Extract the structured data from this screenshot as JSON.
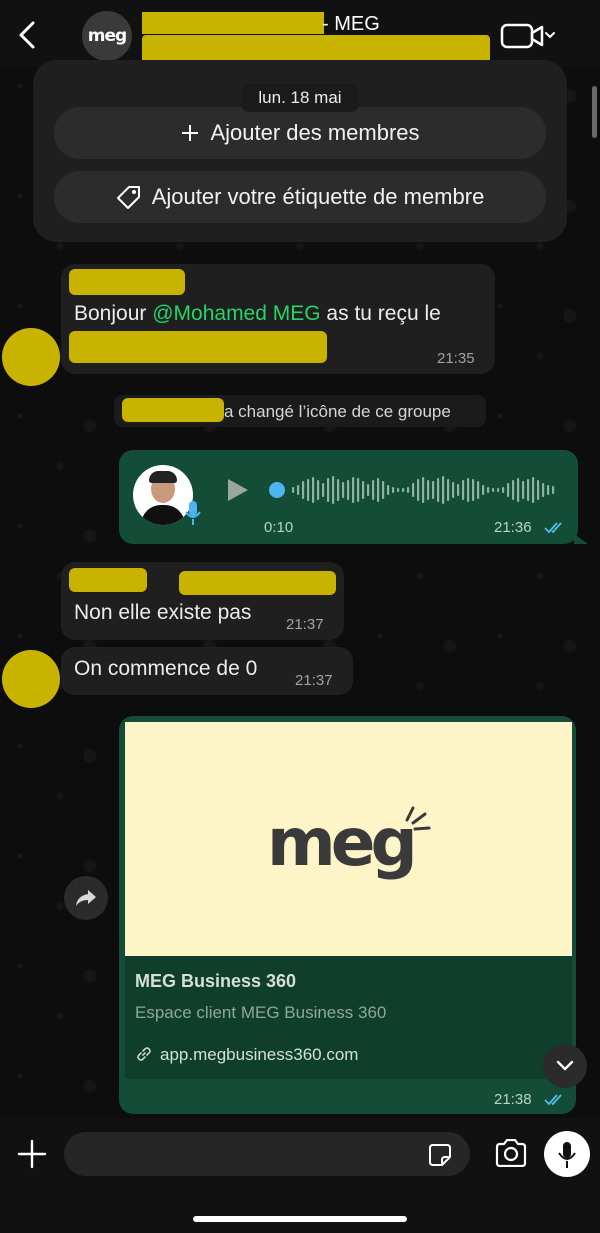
{
  "header": {
    "title_suffix": "- MEG",
    "avatar_text": "meg"
  },
  "date_separator": "lun. 18 mai",
  "top_card": {
    "add_members_label": "Ajouter des membres",
    "add_label_label": "Ajouter votre étiquette de membre"
  },
  "messages": {
    "m1": {
      "text_before": "Bonjour ",
      "mention": "@Mohamed MEG",
      "text_after": " as tu reçu le",
      "time": "21:35"
    },
    "system": {
      "text": "a changé l’icône de ce groupe"
    },
    "voice": {
      "duration": "0:10",
      "time": "21:36"
    },
    "m2": {
      "text": "Non elle existe pas",
      "time": "21:37"
    },
    "m3": {
      "text": "On commence de 0",
      "time": "21:37"
    },
    "link": {
      "logo_text": "meg",
      "title": "MEG Business 360",
      "description": "Espace client MEG Business 360",
      "url": "app.megbusiness360.com",
      "time": "21:38"
    }
  },
  "composer": {
    "placeholder": ""
  },
  "colors": {
    "accent_green": "#25d366",
    "outgoing_bubble": "#144d37",
    "redaction": "#c8b400",
    "read_ticks": "#53bdeb"
  }
}
